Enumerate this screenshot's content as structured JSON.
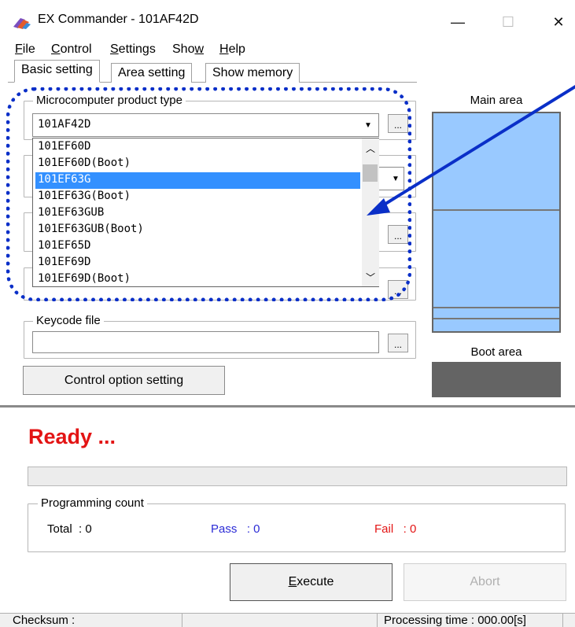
{
  "window": {
    "title": "EX Commander - 101AF42D",
    "minimize_glyph": "—",
    "maximize_glyph": "☐",
    "close_glyph": "✕"
  },
  "menu": [
    {
      "label": "File",
      "mnemonic": "F",
      "rest": "ile"
    },
    {
      "label": "Control",
      "mnemonic": "C",
      "rest": "ontrol"
    },
    {
      "label": "Settings",
      "mnemonic": "S",
      "rest": "ettings"
    },
    {
      "label": "Show",
      "mnemonic": "w",
      "pre": "Sho"
    },
    {
      "label": "Help",
      "mnemonic": "H",
      "rest": "elp"
    }
  ],
  "tabs": [
    "Basic setting",
    "Area setting",
    "Show memory"
  ],
  "product_type": {
    "label": "Microcomputer product type",
    "value": "101AF42D",
    "options": [
      "101EF60D",
      "101EF60D(Boot)",
      "101EF63G",
      "101EF63G(Boot)",
      "101EF63GUB",
      "101EF63GUB(Boot)",
      "101EF65D",
      "101EF69D",
      "101EF69D(Boot)"
    ],
    "selected_option": "101EF63G"
  },
  "dots_label": "...",
  "keycode": {
    "label": "Keycode file",
    "value": ""
  },
  "control_option_button": "Control option setting",
  "right_panel": {
    "main_area_label": "Main area",
    "boot_area_label": "Boot area"
  },
  "status": {
    "ready_text": "Ready ...",
    "progress_fraction": 0
  },
  "programming_count": {
    "label": "Programming count",
    "total": "Total  : 0",
    "pass": "Pass   : 0",
    "fail": "Fail   : 0"
  },
  "buttons": {
    "execute": "Execute",
    "abort": "Abort"
  },
  "statusbar": {
    "checksum": "Checksum :",
    "processing_time": "Processing time :  000.00[s]"
  },
  "colors": {
    "highlight_outline": "#0a2fc8",
    "selected_item": "#3390ff",
    "main_area": "#99c9ff",
    "boot_area": "#646464",
    "ready_text": "#e31414",
    "pass_text": "#2b2bd6",
    "fail_text": "#e31414"
  }
}
